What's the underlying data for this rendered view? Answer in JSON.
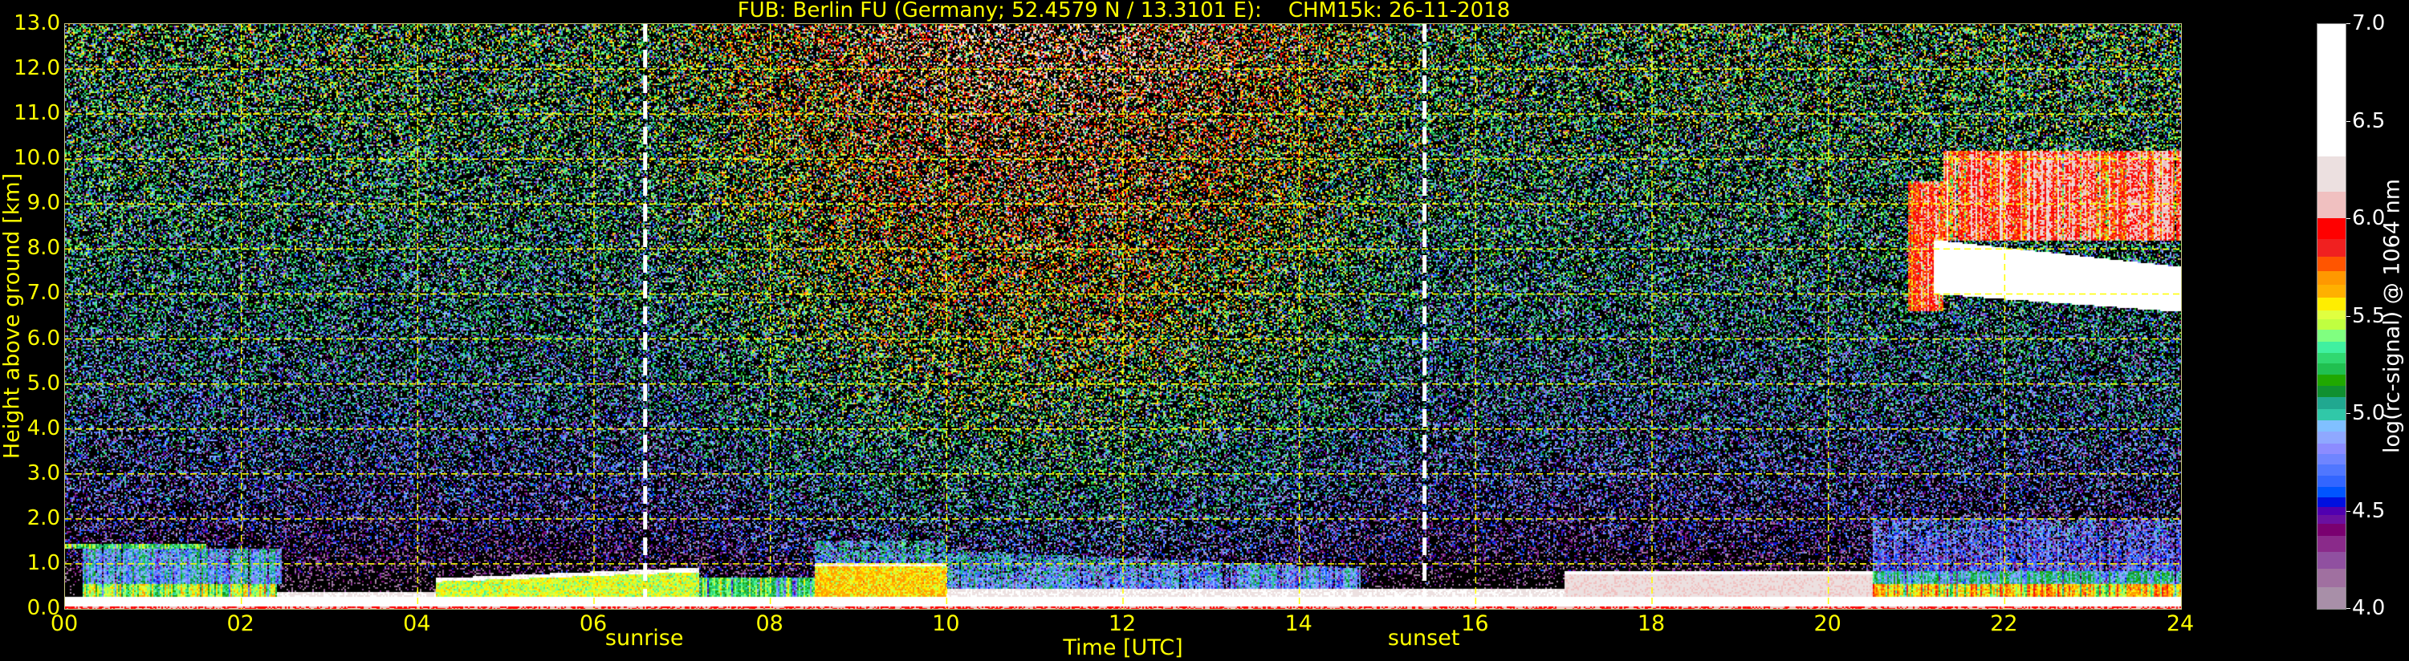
{
  "chart_data": {
    "type": "heatmap",
    "title": "FUB: Berlin FU (Germany; 52.4579 N / 13.3101 E):    CHM15k: 26-11-2018",
    "xlabel": "Time [UTC]",
    "ylabel": "Height above ground [km]",
    "xlim": [
      0,
      24
    ],
    "ylim": [
      0,
      13
    ],
    "x_ticks": [
      "00",
      "02",
      "04",
      "06",
      "08",
      "10",
      "12",
      "14",
      "16",
      "18",
      "20",
      "22",
      "24"
    ],
    "x_tick_values": [
      0,
      2,
      4,
      6,
      8,
      10,
      12,
      14,
      16,
      18,
      20,
      22,
      24
    ],
    "y_ticks": [
      "0.0",
      "1.0",
      "2.0",
      "3.0",
      "4.0",
      "5.0",
      "6.0",
      "7.0",
      "8.0",
      "9.0",
      "10.0",
      "11.0",
      "12.0",
      "13.0"
    ],
    "y_tick_values": [
      0,
      1,
      2,
      3,
      4,
      5,
      6,
      7,
      8,
      9,
      10,
      11,
      12,
      13
    ],
    "grid": true,
    "events": [
      {
        "label": "sunrise",
        "time": 6.58
      },
      {
        "label": "sunset",
        "time": 15.42
      }
    ],
    "colorbar": {
      "label": "log(rc-signal) @ 1064 nm",
      "range": [
        4.0,
        7.0
      ],
      "ticks": [
        "4.0",
        "4.5",
        "5.0",
        "5.5",
        "6.0",
        "6.5",
        "7.0"
      ],
      "tick_values": [
        4.0,
        4.5,
        5.0,
        5.5,
        6.0,
        6.5,
        7.0
      ],
      "levels": [
        {
          "from": 4.0,
          "color": "#a88fa8"
        },
        {
          "from": 4.115,
          "color": "#a070a0"
        },
        {
          "from": 4.207,
          "color": "#9050a0"
        },
        {
          "from": 4.294,
          "color": "#8a2a8a"
        },
        {
          "from": 4.378,
          "color": "#7a0070"
        },
        {
          "from": 4.439,
          "color": "#6a10a0"
        },
        {
          "from": 4.482,
          "color": "#5000b0"
        },
        {
          "from": 4.525,
          "color": "#0010e0"
        },
        {
          "from": 4.573,
          "color": "#0055ff"
        },
        {
          "from": 4.629,
          "color": "#3366ff"
        },
        {
          "from": 4.687,
          "color": "#5077ff"
        },
        {
          "from": 4.741,
          "color": "#6f85ff"
        },
        {
          "from": 4.795,
          "color": "#8c8cff"
        },
        {
          "from": 4.849,
          "color": "#8fa8ff"
        },
        {
          "from": 4.91,
          "color": "#80c0ff"
        },
        {
          "from": 4.968,
          "color": "#30c8a8"
        },
        {
          "from": 5.027,
          "color": "#20a890"
        },
        {
          "from": 5.087,
          "color": "#109030"
        },
        {
          "from": 5.145,
          "color": "#20a800"
        },
        {
          "from": 5.202,
          "color": "#20c050"
        },
        {
          "from": 5.26,
          "color": "#30d870"
        },
        {
          "from": 5.314,
          "color": "#40f0a0"
        },
        {
          "from": 5.372,
          "color": "#80ff80"
        },
        {
          "from": 5.433,
          "color": "#c0ff40"
        },
        {
          "from": 5.487,
          "color": "#e0ff40"
        },
        {
          "from": 5.534,
          "color": "#ffee00"
        },
        {
          "from": 5.599,
          "color": "#ffb000"
        },
        {
          "from": 5.666,
          "color": "#ff9800"
        },
        {
          "from": 5.735,
          "color": "#ff5500"
        },
        {
          "from": 5.807,
          "color": "#f02020"
        },
        {
          "from": 5.898,
          "color": "#ff0000"
        },
        {
          "from": 6.006,
          "color": "#f0c0c0"
        },
        {
          "from": 6.14,
          "color": "#ece0e0"
        },
        {
          "from": 6.325,
          "color": "#ffffff"
        }
      ]
    },
    "features": [
      {
        "name": "surface",
        "t": [
          0,
          24
        ],
        "h": [
          0,
          0.06
        ],
        "level": 6.0
      },
      {
        "name": "near-surface",
        "t": [
          0,
          24
        ],
        "h": [
          0.06,
          0.28
        ],
        "level": 6.5
      },
      {
        "name": "night-mixed-layer",
        "t": [
          0.2,
          2.4
        ],
        "h": [
          0.28,
          0.55
        ],
        "level": 5.45,
        "streaky": true
      },
      {
        "name": "residual-aerosol",
        "t": [
          0.2,
          2.45
        ],
        "h": [
          0.55,
          1.35
        ],
        "level": 4.9,
        "streaky": true
      },
      {
        "name": "aerosol-top",
        "t": [
          0,
          1.6
        ],
        "h": [
          1.35,
          1.45
        ],
        "level": 5.3,
        "streaky": true
      },
      {
        "name": "shallow-layer",
        "t": [
          2.4,
          4.2
        ],
        "h": [
          0.28,
          0.36
        ],
        "level": 6.3
      },
      {
        "name": "morning-bl",
        "t": [
          4.2,
          7.2
        ],
        "h": [
          0.28,
          0.6
        ],
        "h_end": [
          0.28,
          0.82
        ],
        "level": 5.5
      },
      {
        "name": "morning-bl-top",
        "t": [
          4.2,
          7.2
        ],
        "h": [
          0.6,
          0.68
        ],
        "h_end": [
          0.82,
          0.92
        ],
        "level": 6.4
      },
      {
        "name": "bl-transition",
        "t": [
          7.2,
          8.5
        ],
        "h": [
          0.28,
          0.7
        ],
        "level": 5.3,
        "streaky": true
      },
      {
        "name": "midday-bl",
        "t": [
          8.5,
          10
        ],
        "h": [
          0.28,
          0.95
        ],
        "level": 5.6
      },
      {
        "name": "midday-bl-top",
        "t": [
          8.5,
          10
        ],
        "h": [
          0.95,
          1.02
        ],
        "level": 6.3
      },
      {
        "name": "midday-aerosol",
        "t": [
          8.5,
          10
        ],
        "h": [
          1.02,
          1.5
        ],
        "level": 4.85,
        "streaky": true
      },
      {
        "name": "afternoon-surface",
        "t": [
          10,
          17
        ],
        "h": [
          0.28,
          0.45
        ],
        "level": 6.3
      },
      {
        "name": "afternoon-aerosol",
        "t": [
          10,
          14.7
        ],
        "h": [
          0.45,
          1.3
        ],
        "h_end": [
          0.45,
          0.9
        ],
        "level": 4.8,
        "streaky": true
      },
      {
        "name": "evening-bl",
        "t": [
          17,
          20.5
        ],
        "h": [
          0.28,
          0.75
        ],
        "level": 6.2
      },
      {
        "name": "evening-bl-top",
        "t": [
          17,
          20.5
        ],
        "h": [
          0.75,
          0.85
        ],
        "level": 6.5
      },
      {
        "name": "late-bl",
        "t": [
          20.5,
          24
        ],
        "h": [
          0.28,
          0.55
        ],
        "level": 5.6,
        "streaky": true
      },
      {
        "name": "late-aerosol",
        "t": [
          20.5,
          24
        ],
        "h": [
          0.55,
          0.85
        ],
        "level": 5.0,
        "streaky": true
      },
      {
        "name": "late-haze",
        "t": [
          20.5,
          24
        ],
        "h": [
          0.85,
          2.0
        ],
        "level": 4.55,
        "streaky": true
      },
      {
        "name": "cloud-core",
        "t": [
          21.2,
          24
        ],
        "h": [
          7.0,
          8.2
        ],
        "h_end": [
          6.6,
          7.6
        ],
        "level": 6.6
      },
      {
        "name": "cloud-upper",
        "t": [
          21.3,
          24
        ],
        "h": [
          8.2,
          10.2
        ],
        "level": 5.95,
        "streaky": true
      },
      {
        "name": "cloud-streaks",
        "t": [
          20.9,
          21.3
        ],
        "h": [
          6.6,
          9.5
        ],
        "level": 5.9,
        "streaky": true
      }
    ]
  }
}
